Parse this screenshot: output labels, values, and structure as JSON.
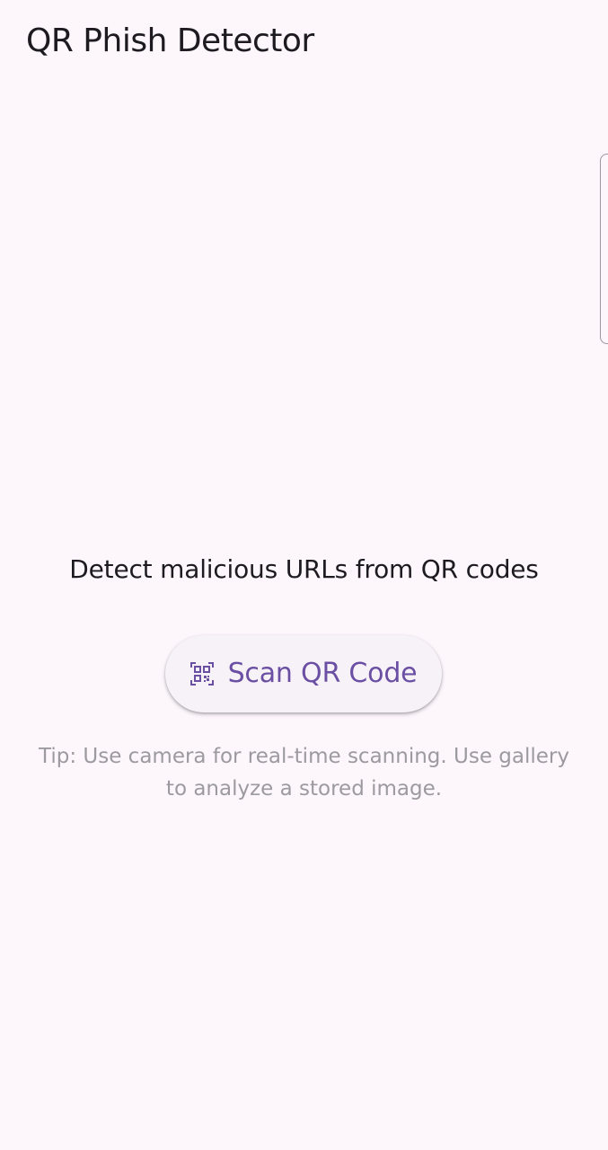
{
  "app_bar": {
    "title": "QR Phish Detector"
  },
  "main": {
    "subtitle": "Detect malicious URLs from QR codes",
    "scan_button": {
      "label": "Scan QR Code",
      "icon": "qr-code-scanner-icon"
    },
    "tip": "Tip: Use camera for real-time scanning. Use gallery to analyze a stored image."
  },
  "colors": {
    "background": "#fdf7fc",
    "title_text": "#1d1b20",
    "button_background": "#f7f1f8",
    "button_accent": "#6a4fa3",
    "tip_text": "#9c9a9e"
  }
}
